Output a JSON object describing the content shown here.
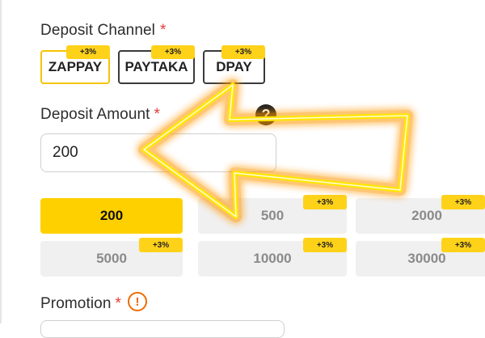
{
  "deposit_channel": {
    "label": "Deposit Channel",
    "required_mark": "*",
    "channels": [
      {
        "name": "ZAPPAY",
        "bonus": "+3%",
        "selected": true
      },
      {
        "name": "PAYTAKA",
        "bonus": "+3%",
        "selected": false
      },
      {
        "name": "DPAY",
        "bonus": "+3%",
        "selected": false
      }
    ]
  },
  "deposit_amount": {
    "label": "Deposit Amount",
    "required_mark": "*",
    "help_icon": "question-circle-icon",
    "help_glyph": "?",
    "value": "200",
    "options": [
      {
        "value": "200",
        "bonus": "",
        "selected": true
      },
      {
        "value": "500",
        "bonus": "+3%",
        "selected": false
      },
      {
        "value": "2000",
        "bonus": "+3%",
        "selected": false
      },
      {
        "value": "5000",
        "bonus": "+3%",
        "selected": false
      },
      {
        "value": "10000",
        "bonus": "+3%",
        "selected": false
      },
      {
        "value": "30000",
        "bonus": "+3%",
        "selected": false
      }
    ]
  },
  "promotion": {
    "label": "Promotion",
    "required_mark": "*",
    "info_icon": "exclamation-circle-icon",
    "info_glyph": "!"
  },
  "overlay": {
    "icon": "glowing-arrow-left-icon",
    "color": "#ffe600",
    "glow": "#ff9800"
  },
  "colors": {
    "accent": "#ffd000",
    "required": "#e53935",
    "warning": "#ef6c00"
  }
}
